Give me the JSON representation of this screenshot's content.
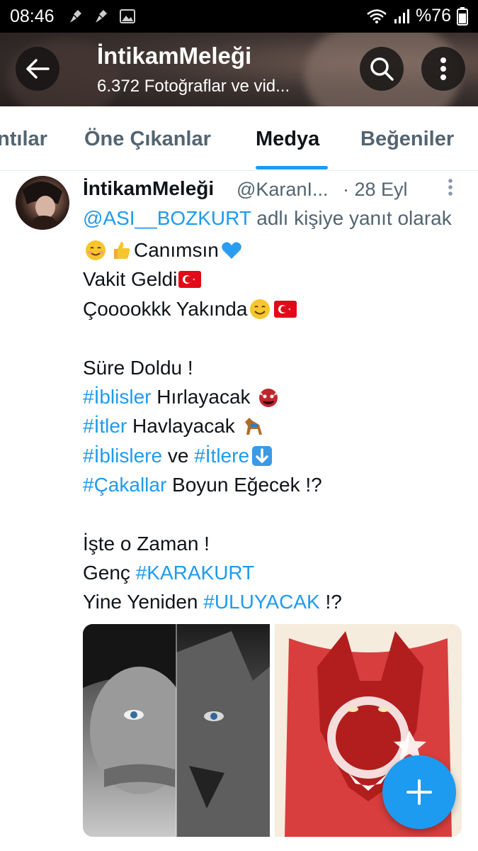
{
  "status_bar": {
    "time": "08:46",
    "battery": "%76"
  },
  "header": {
    "title": "İntikamMeleği",
    "subtitle": "6.372 Fotoğraflar ve vid..."
  },
  "tabs": [
    {
      "label": "ıntılar"
    },
    {
      "label": "Öne Çıkanlar"
    },
    {
      "label": "Medya",
      "active": true
    },
    {
      "label": "Beğeniler"
    }
  ],
  "tweet": {
    "name": "İntikamMeleği",
    "handle": "@KaranI...",
    "date": "· 28 Eyl",
    "reply_mention": "@ASI__BOZKURT",
    "reply_text": " adlı kişiye yanıt olarak",
    "lines": {
      "l1": "Canımsın",
      "l2": "Vakit Geldi",
      "l3": "Çooookkk Yakında ",
      "l4": "Süre Doldu !",
      "l5_tag": "#İblisler",
      "l5_text": " Hırlayacak ",
      "l6_tag": "#İtler",
      "l6_text": " Havlayacak ",
      "l7_tag1": "#İblislere",
      "l7_mid": " ve ",
      "l7_tag2": "#İtlere",
      "l8_tag": "#Çakallar",
      "l8_text": " Boyun Eğecek !?",
      "l9": "İşte o Zaman !",
      "l10_text": "Genç ",
      "l10_tag": "#KARAKURT",
      "l11_text": "Yine Yeniden ",
      "l11_tag": "#ULUYACAK",
      "l11_end": " !?"
    }
  },
  "colors": {
    "accent": "#1d9bf0",
    "text": "#0f1419",
    "muted": "#536471"
  },
  "icons": [
    "back-arrow-icon",
    "search-icon",
    "more-vertical-icon",
    "plus-icon",
    "wifi-icon",
    "signal-icon",
    "battery-icon"
  ]
}
